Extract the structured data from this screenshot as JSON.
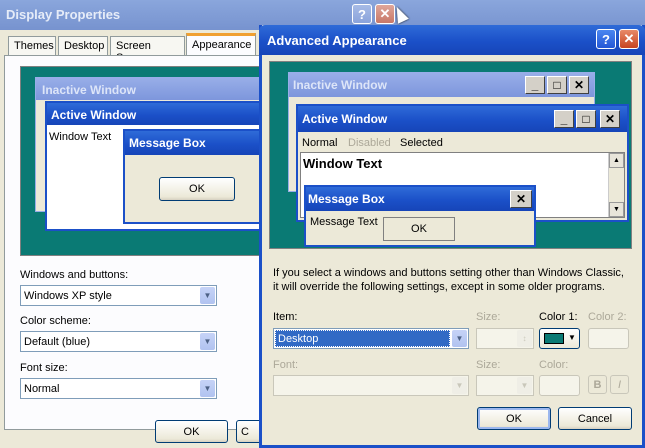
{
  "display_properties": {
    "title": "Display Properties",
    "tabs": [
      "Themes",
      "Desktop",
      "Screen Saver",
      "Appearance"
    ],
    "preview": {
      "inactive_title": "Inactive Window",
      "active_title": "Active Window",
      "window_text": "Window Text",
      "msgbox_title": "Message Box",
      "ok_label": "OK"
    },
    "windows_buttons_label": "Windows and buttons:",
    "windows_buttons_value": "Windows XP style",
    "color_scheme_label": "Color scheme:",
    "color_scheme_value": "Default (blue)",
    "font_size_label": "Font size:",
    "font_size_value": "Normal",
    "ok_label": "OK",
    "cancel_label_visible": "C"
  },
  "advanced": {
    "title": "Advanced Appearance",
    "preview": {
      "inactive_title": "Inactive Window",
      "active_title": "Active Window",
      "menu_normal": "Normal",
      "menu_disabled": "Disabled",
      "menu_selected": "Selected",
      "window_text": "Window Text",
      "msgbox_title": "Message Box",
      "msgbox_text": "Message Text",
      "ok_label": "OK"
    },
    "info_text": "If you select a windows and buttons setting other than Windows Classic, it will override the following settings, except in some older programs.",
    "item_label": "Item:",
    "item_value": "Desktop",
    "size_label": "Size:",
    "color1_label": "Color 1:",
    "color2_label": "Color 2:",
    "font_label": "Font:",
    "size2_label": "Size:",
    "color_label": "Color:",
    "bold_label": "B",
    "italic_label": "I",
    "ok_label": "OK",
    "cancel_label": "Cancel"
  },
  "colors": {
    "desktop_teal": "#0a7a74",
    "xp_blue": "#1b50c8",
    "dialog_bg": "#ece9d8"
  }
}
